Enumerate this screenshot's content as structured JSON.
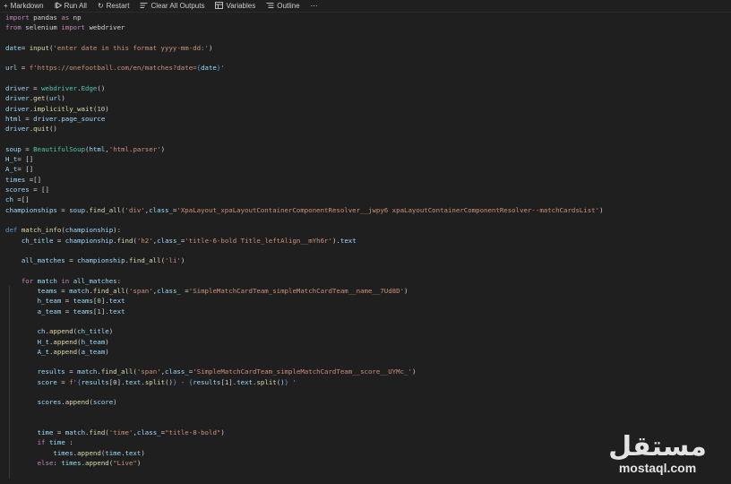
{
  "toolbar": {
    "items": [
      {
        "icon": "plus-icon",
        "label": "Markdown"
      },
      {
        "icon": "run-all-icon",
        "label": "Run All"
      },
      {
        "icon": "restart-icon",
        "label": "Restart"
      },
      {
        "icon": "clear-outputs-icon",
        "label": "Clear All Outputs"
      },
      {
        "icon": "variables-icon",
        "label": "Variables"
      },
      {
        "icon": "outline-icon",
        "label": "Outline"
      },
      {
        "icon": "more-icon",
        "label": "⋯"
      }
    ]
  },
  "code": {
    "l1a": "import",
    "l1b": " pandas ",
    "l1c": "as",
    "l1d": " np",
    "l2a": "from",
    "l2b": " selenium ",
    "l2c": "import",
    "l2d": " webdriver",
    "l4a": "date",
    "l4b": "= ",
    "l4c": "input",
    "l4d": "(",
    "l4e": "'enter date in this format yyyy-mm-dd:'",
    "l4f": ")",
    "l6a": "url",
    "l6b": " = ",
    "l6c": "f'https://onefootball.com/en/matches?date=",
    "l6d": "{",
    "l6e": "date",
    "l6f": "}",
    "l6g": "'",
    "l8a": "driver",
    "l8b": " = ",
    "l8c": "webdriver",
    "l8d": ".",
    "l8e": "Edge",
    "l8f": "()",
    "l9a": "driver",
    "l9b": ".",
    "l9c": "get",
    "l9d": "(",
    "l9e": "url",
    "l9f": ")",
    "l10a": "driver",
    "l10b": ".",
    "l10c": "implicitly_wait",
    "l10d": "(",
    "l10e": "10",
    "l10f": ")",
    "l11a": "html",
    "l11b": " = ",
    "l11c": "driver",
    "l11d": ".",
    "l11e": "page_source",
    "l12a": "driver",
    "l12b": ".",
    "l12c": "quit",
    "l12d": "()",
    "l14a": "soup",
    "l14b": " = ",
    "l14c": "BeautifulSoup",
    "l14d": "(",
    "l14e": "html",
    "l14f": ",",
    "l14g": "'html.parser'",
    "l14h": ")",
    "l15a": "H_t",
    "l15b": "= []",
    "l16a": "A_t",
    "l16b": "= []",
    "l17a": "times",
    "l17b": " =[]",
    "l18a": "scores",
    "l18b": " = []",
    "l19a": "ch",
    "l19b": " =[]",
    "l20a": "championships",
    "l20b": " = ",
    "l20c": "soup",
    "l20d": ".",
    "l20e": "find_all",
    "l20f": "(",
    "l20g": "'div'",
    "l20h": ",",
    "l20i": "class_",
    "l20j": "=",
    "l20k": "'XpaLayout_xpaLayoutContainerComponentResolver__jwpy6 xpaLayoutContainerComponentResolver--matchCardsList'",
    "l20l": ")",
    "l22a": "def",
    "l22b": " ",
    "l22c": "match_info",
    "l22d": "(",
    "l22e": "championship",
    "l22f": "):",
    "l23a": "    ",
    "l23b": "ch_title",
    "l23c": " = ",
    "l23d": "championship",
    "l23e": ".",
    "l23f": "find",
    "l23g": "(",
    "l23h": "'h2'",
    "l23i": ",",
    "l23j": "class_",
    "l23k": "=",
    "l23l": "'title-6-bold Title_leftAlign__mYh6r'",
    "l23m": ").",
    "l23n": "text",
    "l25a": "    ",
    "l25b": "all_matches",
    "l25c": " = ",
    "l25d": "championship",
    "l25e": ".",
    "l25f": "find_all",
    "l25g": "(",
    "l25h": "'li'",
    "l25i": ")",
    "l27a": "    ",
    "l27b": "for",
    "l27c": " ",
    "l27d": "match",
    "l27e": " ",
    "l27f": "in",
    "l27g": " ",
    "l27h": "all_matches",
    "l27i": ":",
    "l28a": "        ",
    "l28b": "teams",
    "l28c": " = ",
    "l28d": "match",
    "l28e": ".",
    "l28f": "find_all",
    "l28g": "(",
    "l28h": "'span'",
    "l28i": ",",
    "l28j": "class_",
    "l28k": " =",
    "l28l": "'SimpleMatchCardTeam_simpleMatchCardTeam__name__7Ud8D'",
    "l28m": ")",
    "l29a": "        ",
    "l29b": "h_team",
    "l29c": " = ",
    "l29d": "teams",
    "l29e": "[",
    "l29f": "0",
    "l29g": "].",
    "l29h": "text",
    "l30a": "        ",
    "l30b": "a_team",
    "l30c": " = ",
    "l30d": "teams",
    "l30e": "[",
    "l30f": "1",
    "l30g": "].",
    "l30h": "text",
    "l32a": "        ",
    "l32b": "ch",
    "l32c": ".",
    "l32d": "append",
    "l32e": "(",
    "l32f": "ch_title",
    "l32g": ")",
    "l33a": "        ",
    "l33b": "H_t",
    "l33c": ".",
    "l33d": "append",
    "l33e": "(",
    "l33f": "h_team",
    "l33g": ")",
    "l34a": "        ",
    "l34b": "A_t",
    "l34c": ".",
    "l34d": "append",
    "l34e": "(",
    "l34f": "a_team",
    "l34g": ")",
    "l36a": "        ",
    "l36b": "results",
    "l36c": " = ",
    "l36d": "match",
    "l36e": ".",
    "l36f": "find_all",
    "l36g": "(",
    "l36h": "'span'",
    "l36i": ",",
    "l36j": "class_",
    "l36k": "=",
    "l36l": "'SimpleMatchCardTeam_simpleMatchCardTeam__score__UYMc_'",
    "l36m": ")",
    "l37a": "        ",
    "l37b": "score",
    "l37c": " = ",
    "l37d": "f'",
    "l37e": "{",
    "l37f": "results",
    "l37g": "[0].",
    "l37h": "text",
    "l37i": ".",
    "l37j": "split",
    "l37k": "()",
    "l37l": "}",
    "l37m": " - ",
    "l37n": "{",
    "l37o": "results",
    "l37p": "[1].",
    "l37q": "text",
    "l37r": ".",
    "l37s": "split",
    "l37t": "()",
    "l37u": "}",
    "l37v": " '",
    "l39a": "        ",
    "l39b": "scores",
    "l39c": ".",
    "l39d": "append",
    "l39e": "(",
    "l39f": "score",
    "l39g": ")",
    "l42a": "        ",
    "l42b": "time",
    "l42c": " = ",
    "l42d": "match",
    "l42e": ".",
    "l42f": "find",
    "l42g": "(",
    "l42h": "'time'",
    "l42i": ",",
    "l42j": "class_",
    "l42k": "=",
    "l42l": "\"title-8-bold\"",
    "l42m": ")",
    "l43a": "        ",
    "l43b": "if",
    "l43c": " ",
    "l43d": "time",
    "l43e": " :",
    "l44a": "            ",
    "l44b": "times",
    "l44c": ".",
    "l44d": "append",
    "l44e": "(",
    "l44f": "time",
    "l44g": ".",
    "l44h": "text",
    "l44i": ")",
    "l45a": "        ",
    "l45b": "else",
    "l45c": ": ",
    "l45d": "times",
    "l45e": ".",
    "l45f": "append",
    "l45g": "(",
    "l45h": "\"Live\"",
    "l45i": ")"
  },
  "watermark": {
    "arabic": "مستقل",
    "latin": "mostaql.com"
  }
}
